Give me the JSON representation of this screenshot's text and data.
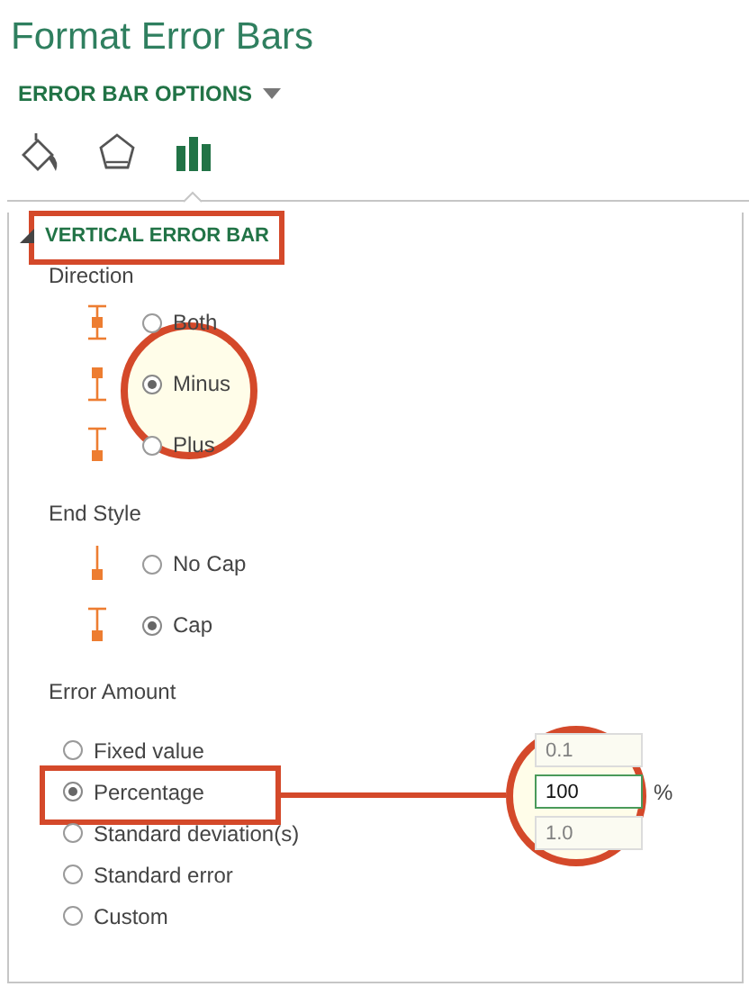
{
  "title": "Format Error Bars",
  "options_menu": {
    "label": "ERROR BAR OPTIONS"
  },
  "icon_tabs": [
    {
      "kind": "fill",
      "selected": false
    },
    {
      "kind": "effects",
      "selected": false
    },
    {
      "kind": "options",
      "selected": true
    }
  ],
  "section": {
    "label": "VERTICAL ERROR BAR",
    "expanded": true
  },
  "direction": {
    "label": "Direction",
    "options": [
      {
        "kind": "both",
        "label": "Both",
        "selected": false
      },
      {
        "kind": "minus",
        "label": "Minus",
        "selected": true
      },
      {
        "kind": "plus",
        "label": "Plus",
        "selected": false
      }
    ]
  },
  "end_style": {
    "label": "End Style",
    "options": [
      {
        "kind": "nocap",
        "label": "No Cap",
        "selected": false
      },
      {
        "kind": "cap",
        "label": "Cap",
        "selected": true
      }
    ]
  },
  "error_amount": {
    "label": "Error Amount",
    "options": [
      {
        "label": "Fixed value",
        "selected": false,
        "field": {
          "value": "0.1",
          "disabled": true
        }
      },
      {
        "label": "Percentage",
        "selected": true,
        "field": {
          "value": "100",
          "disabled": false,
          "unit": "%"
        }
      },
      {
        "label": "Standard deviation(s)",
        "selected": false,
        "field": {
          "value": "1.0",
          "disabled": true
        }
      },
      {
        "label": "Standard error",
        "selected": false
      },
      {
        "label": "Custom",
        "selected": false
      }
    ]
  }
}
